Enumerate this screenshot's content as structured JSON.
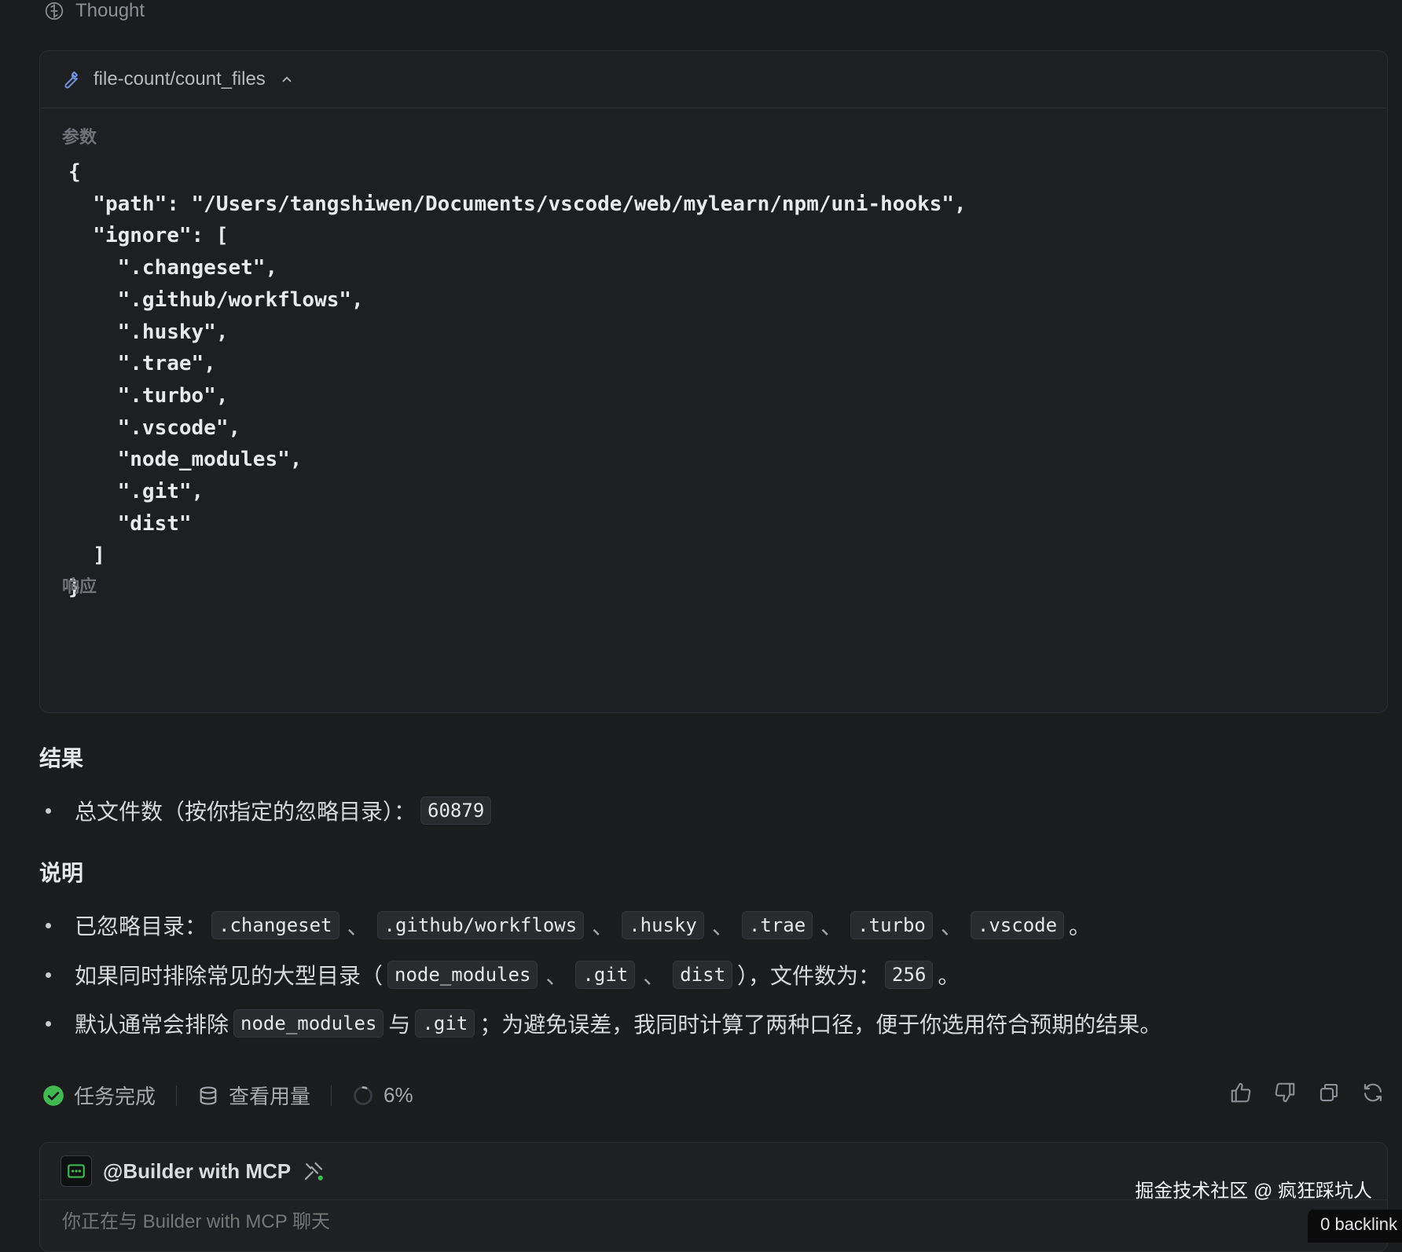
{
  "thought": {
    "label": "Thought"
  },
  "tool": {
    "name": "file-count/count_files",
    "params_label": "参数",
    "params_code": "{\n  \"path\": \"/Users/tangshiwen/Documents/vscode/web/mylearn/npm/uni-hooks\",\n  \"ignore\": [\n    \".changeset\",\n    \".github/workflows\",\n    \".husky\",\n    \".trae\",\n    \".turbo\",\n    \".vscode\",\n    \"node_modules\",\n    \".git\",\n    \"dist\"\n  ]\n}",
    "response_label": "响应"
  },
  "result": {
    "heading": "结果",
    "total_label": "总文件数（按你指定的忽略目录）：",
    "total_value": "60879"
  },
  "notes": {
    "heading": "说明",
    "item1_prefix": "已忽略目录：",
    "ignored": [
      ".changeset",
      ".github/workflows",
      ".husky",
      ".trae",
      ".turbo",
      ".vscode"
    ],
    "sep": "、",
    "period": "。",
    "item2_prefix": "如果同时排除常见的大型目录（",
    "item2_dirs": [
      "node_modules",
      ".git",
      "dist"
    ],
    "item2_mid": "），文件数为：",
    "item2_value": "256",
    "item3_prefix": "默认通常会排除",
    "item3_a": "node_modules",
    "item3_and": "与",
    "item3_b": ".git",
    "item3_suffix": "；为避免误差，我同时计算了两种口径，便于你选用符合预期的结果。"
  },
  "status": {
    "done": "任务完成",
    "usage": "查看用量",
    "progress": "6%"
  },
  "input": {
    "agent": "@Builder with MCP",
    "placeholder": "你正在与 Builder with MCP 聊天"
  },
  "watermark": "掘金技术社区 @ 疯狂踩坑人",
  "backlink": "0 backlink",
  "colors": {
    "success": "#3fb950",
    "wrench": "#6f8fd8",
    "accent_dot": "#3fb950"
  }
}
